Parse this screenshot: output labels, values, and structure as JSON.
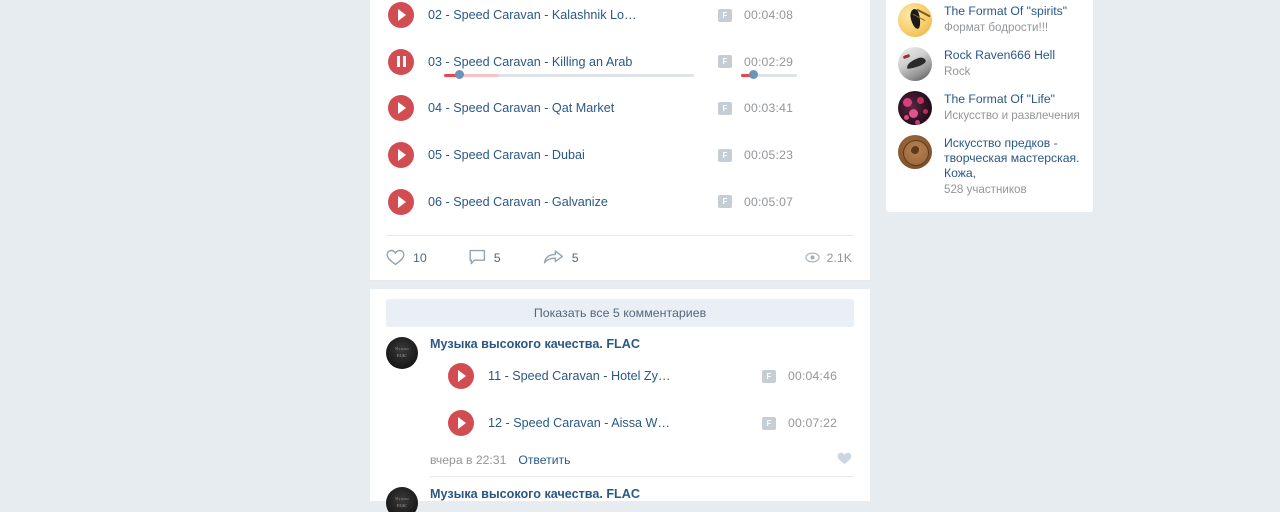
{
  "post": {
    "tracks": [
      {
        "title": "02 - Speed Caravan - Kalashnik Lo…",
        "quality": "F",
        "duration": "00:04:08",
        "state": "paused"
      },
      {
        "title": "03 - Speed Caravan - Killing an Arab",
        "quality": "F",
        "duration": "00:02:29",
        "state": "playing"
      },
      {
        "title": "04 - Speed Caravan - Qat Market",
        "quality": "F",
        "duration": "00:03:41",
        "state": "paused"
      },
      {
        "title": "05 - Speed Caravan - Dubai",
        "quality": "F",
        "duration": "00:05:23",
        "state": "paused"
      },
      {
        "title": "06 - Speed Caravan - Galvanize",
        "quality": "F",
        "duration": "00:05:07",
        "state": "paused"
      }
    ],
    "player": {
      "progress_percent": 6,
      "buffer_percent": 22,
      "volume_percent": 22
    },
    "actions": {
      "likes": "10",
      "comments": "5",
      "shares": "5",
      "views": "2.1K"
    }
  },
  "comments": {
    "show_all_label": "Показать все 5 комментариев",
    "items": [
      {
        "author": "Музыка высокого качества. FLAC",
        "avatar_line1": "Музыка",
        "avatar_line2": "FLAC",
        "tracks": [
          {
            "title": "11 - Speed Caravan - Hotel Zy…",
            "quality": "F",
            "duration": "00:04:46"
          },
          {
            "title": "12 - Speed Caravan - Aissa W…",
            "quality": "F",
            "duration": "00:07:22"
          }
        ],
        "time": "вчера в 22:31",
        "reply_label": "Ответить"
      },
      {
        "author": "Музыка высокого качества. FLAC",
        "avatar_line1": "Музыка",
        "avatar_line2": "FLAC",
        "tracks": [],
        "time": "",
        "reply_label": ""
      }
    ]
  },
  "sidebar": {
    "groups": [
      {
        "title": "The Format Of \"spirits\"",
        "subtitle": "Формат бодрости!!!",
        "avatar": "spirits-avatar"
      },
      {
        "title": "Rock Raven666 Hell",
        "subtitle": "Rock",
        "avatar": "raven-avatar"
      },
      {
        "title": "The Format Of \"Life\"",
        "subtitle": "Искусство и развлечения",
        "avatar": "life-avatar"
      },
      {
        "title": "Искусство предков - творческая мастерская. Кожа,",
        "subtitle": "528 участников",
        "avatar": "ancestors-avatar"
      }
    ]
  },
  "colors": {
    "page_bg": "#e7ecf0",
    "accent_red": "#d24d52",
    "link_blue": "#2a5885",
    "muted": "#939699",
    "progress_red": "#e8474e",
    "knob_blue": "#6d93b8"
  }
}
